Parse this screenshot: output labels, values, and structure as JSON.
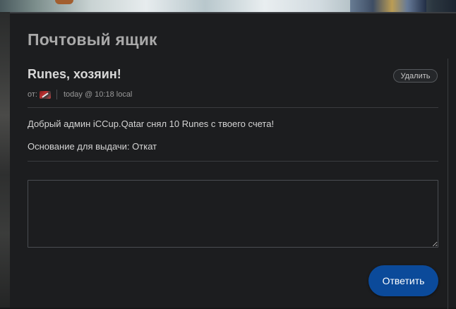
{
  "mailbox": {
    "title": "Почтовый ящик"
  },
  "message": {
    "subject": "Runes, хозяин!",
    "delete_label": "Удалить",
    "from_label": "от:",
    "timestamp": "today @ 10:18 local",
    "body_line_1": "Добрый админ iCCup.Qatar снял 10 Runes с твоего счета!",
    "body_line_2": "Основание для выдачи: Откат"
  },
  "reply": {
    "input_value": "",
    "button_label": "Ответить"
  },
  "colors": {
    "panel_bg": "#1c1d1f",
    "accent_button": "#0b4a9a"
  }
}
